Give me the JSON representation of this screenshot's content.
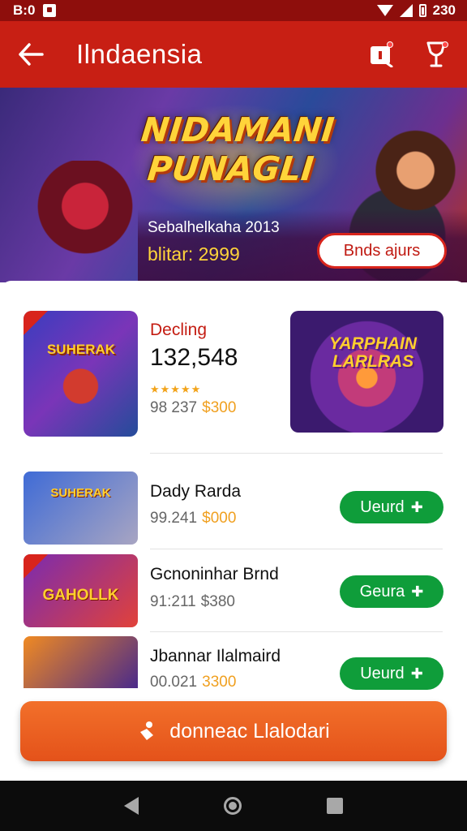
{
  "status_bar": {
    "left_text": "B:0",
    "right_text": "230"
  },
  "app_bar": {
    "title": "Ilndaensia",
    "back_icon": "arrow-left-icon",
    "icons": [
      "notification-icon",
      "trophy-icon"
    ]
  },
  "banner": {
    "title_line1": "NIDAMANI",
    "title_line2": "PUNAGLI",
    "subtitle": "Sebalhelkaha 2013",
    "price_text": "blitar: 2999",
    "button_label": "Bnds ajurs"
  },
  "featured": {
    "thumb_text": "SUHERAK",
    "tag": "Decling",
    "count": "132,548",
    "stars": "★★★★★",
    "old_price": "98 237",
    "new_price": "$300",
    "art_text": "YARPHAIN LARLRAS"
  },
  "list": [
    {
      "title": "Dady Rarda",
      "old_price": "99.241",
      "new_price": "$000",
      "button": "Ueurd",
      "thumb_text": "SUHERAK",
      "thumb_colors": [
        "#3f6bd6",
        "#a8a5c2"
      ]
    },
    {
      "title": "Gcnoninhar Brnd",
      "old_price": "91:211",
      "new_price": "$380",
      "button": "Geura",
      "thumb_text": "GAHOLLK",
      "thumb_colors": [
        "#7a2bb0",
        "#e1423a"
      ]
    },
    {
      "title": "Jbannar Ilalmaird",
      "old_price": "00.021",
      "new_price": "3300",
      "button": "Ueurd",
      "thumb_text": "",
      "thumb_colors": [
        "#f08a22",
        "#4a2a8a"
      ]
    }
  ],
  "cta": {
    "label": "donneac Llalodari"
  },
  "colors": {
    "primary_red": "#c81f14",
    "accent_orange": "#e4521a",
    "button_green": "#0f9d3a",
    "price_gold": "#f0a020"
  }
}
